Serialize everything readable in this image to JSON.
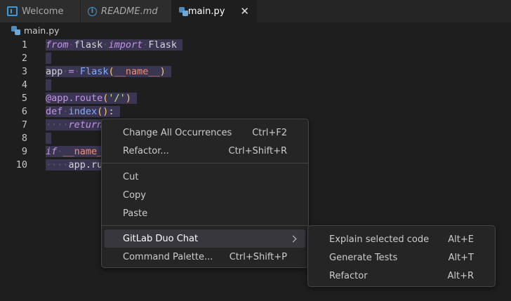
{
  "tabs": [
    {
      "label": "Welcome",
      "icon": "vscode-icon"
    },
    {
      "label": "README.md",
      "icon": "info-icon"
    },
    {
      "label": "main.py",
      "icon": "python-icon",
      "close": "✕"
    }
  ],
  "breadcrumb": {
    "label": "main.py",
    "icon": "python-icon"
  },
  "editor": {
    "line_numbers": [
      "1",
      "2",
      "3",
      "4",
      "5",
      "6",
      "7",
      "8",
      "9",
      "10"
    ]
  },
  "context_menu": {
    "items": [
      {
        "label": "Change All Occurrences",
        "shortcut": "Ctrl+F2"
      },
      {
        "label": "Refactor...",
        "shortcut": "Ctrl+Shift+R"
      },
      {
        "label": "Cut",
        "shortcut": ""
      },
      {
        "label": "Copy",
        "shortcut": ""
      },
      {
        "label": "Paste",
        "shortcut": ""
      },
      {
        "label": "GitLab Duo Chat",
        "shortcut": ""
      },
      {
        "label": "Command Palette...",
        "shortcut": "Ctrl+Shift+P"
      }
    ]
  },
  "submenu": {
    "items": [
      {
        "label": "Explain selected code",
        "shortcut": "Alt+E"
      },
      {
        "label": "Generate Tests",
        "shortcut": "Alt+T"
      },
      {
        "label": "Refactor",
        "shortcut": "Alt+R"
      }
    ]
  },
  "colors": {
    "editor_bg": "#1e1e1e",
    "selection": "#3a3550",
    "keyword": "#c792ea",
    "function": "#82aaff",
    "string": "#c3e88d"
  }
}
